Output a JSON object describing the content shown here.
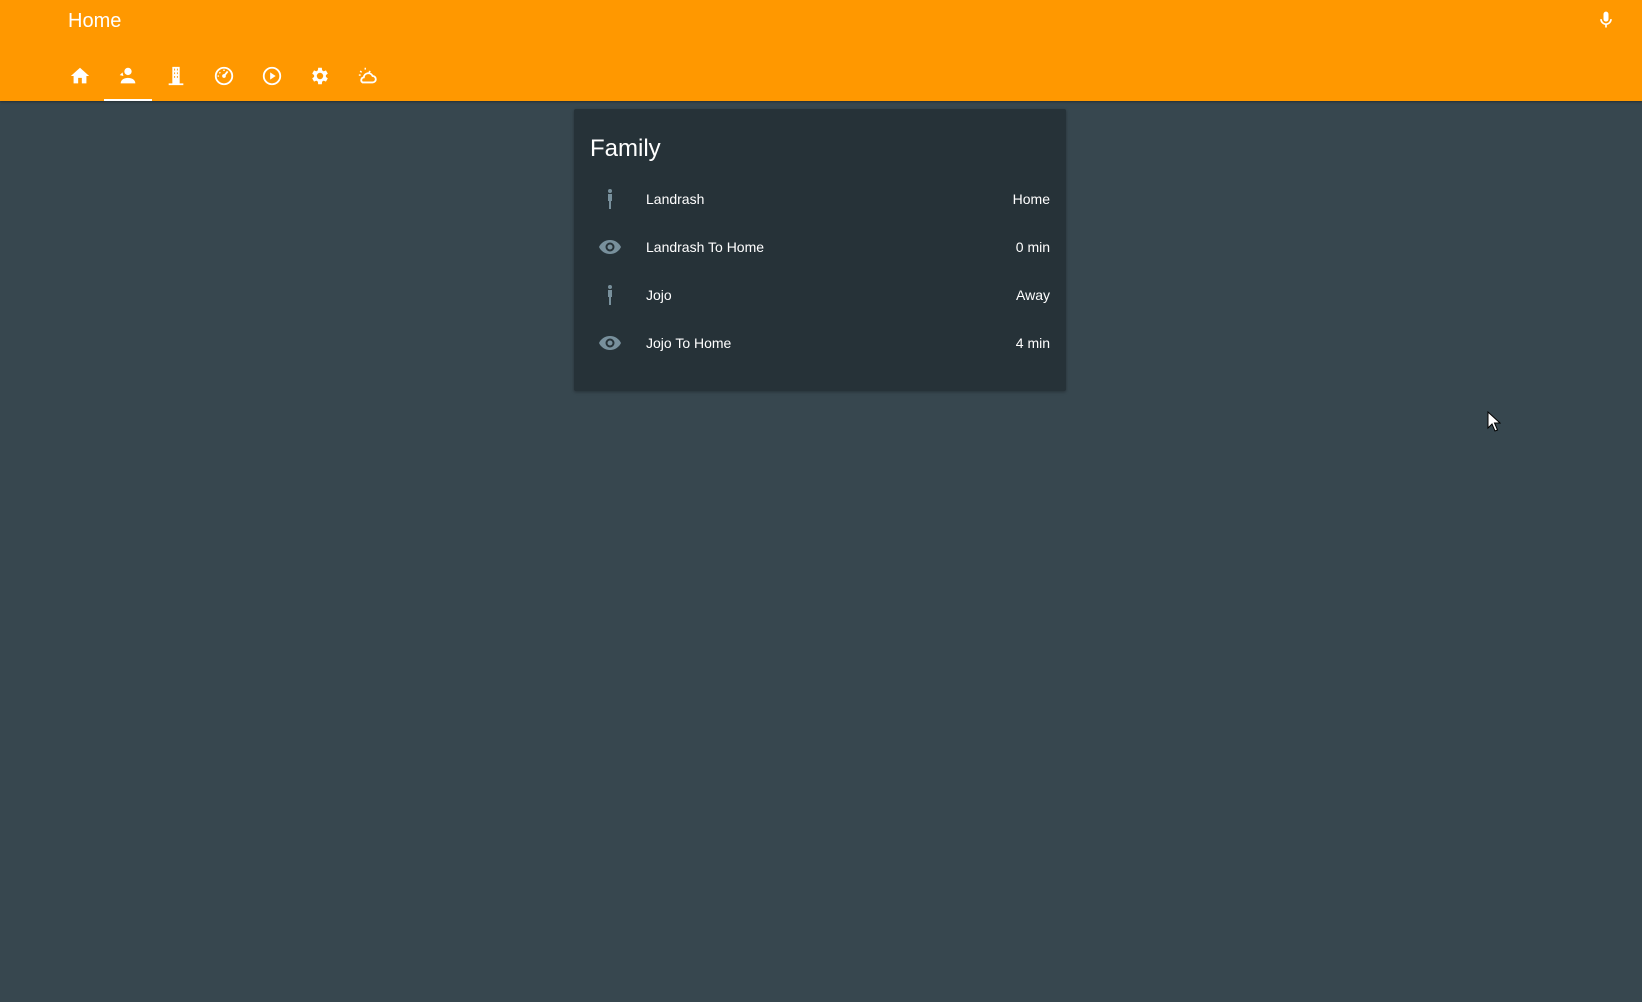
{
  "header": {
    "title": "Home",
    "background_color": "#ff9800",
    "mic_icon": "microphone-icon"
  },
  "tabs": [
    {
      "icon": "home-icon",
      "active": false
    },
    {
      "icon": "account-location-icon",
      "active": true
    },
    {
      "icon": "office-building-icon",
      "active": false
    },
    {
      "icon": "gauge-icon",
      "active": false
    },
    {
      "icon": "play-circle-icon",
      "active": false
    },
    {
      "icon": "settings-icon",
      "active": false
    },
    {
      "icon": "weather-partly-cloudy-icon",
      "active": false
    }
  ],
  "card": {
    "title": "Family",
    "rows": [
      {
        "icon": "person-icon",
        "name": "Landrash",
        "state": "Home"
      },
      {
        "icon": "eye-icon",
        "name": "Landrash To Home",
        "state": "0 min"
      },
      {
        "icon": "person-icon",
        "name": "Jojo",
        "state": "Away"
      },
      {
        "icon": "eye-icon",
        "name": "Jojo To Home",
        "state": "4 min"
      }
    ]
  },
  "colors": {
    "page_background": "#37474f",
    "card_background": "#263238",
    "icon_muted": "#78909c",
    "text": "#ffffff"
  }
}
